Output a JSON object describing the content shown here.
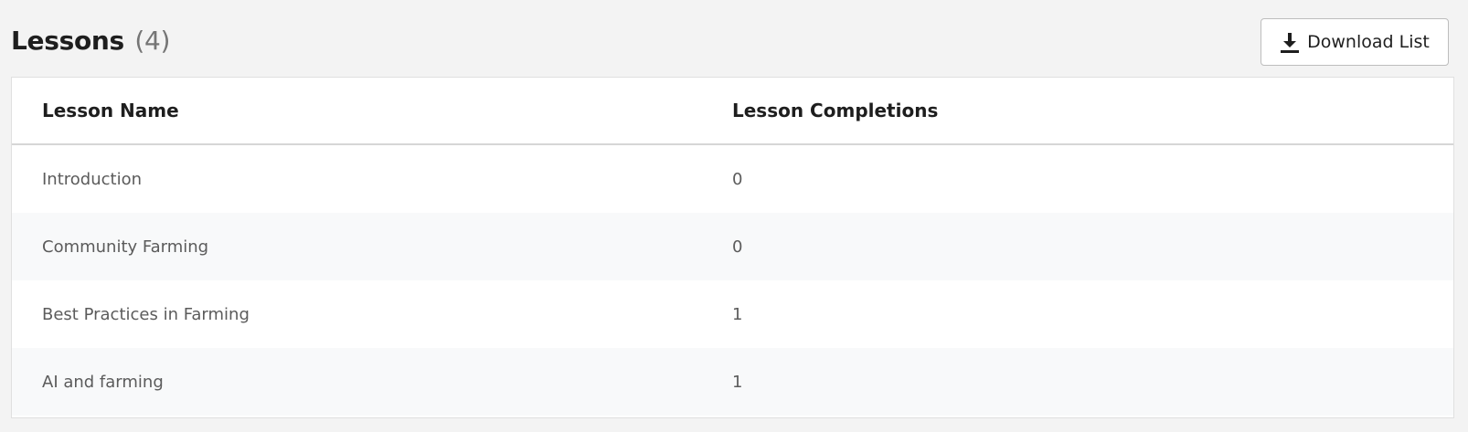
{
  "header": {
    "title": "Lessons",
    "count": "(4)",
    "download_label": "Download List",
    "download_icon": "download-icon"
  },
  "table": {
    "columns": [
      "Lesson Name",
      "Lesson Completions"
    ],
    "rows": [
      {
        "name": "Introduction",
        "completions": "0"
      },
      {
        "name": "Community Farming",
        "completions": "0"
      },
      {
        "name": "Best Practices in Farming",
        "completions": "1"
      },
      {
        "name": "AI and farming",
        "completions": "1"
      }
    ]
  }
}
